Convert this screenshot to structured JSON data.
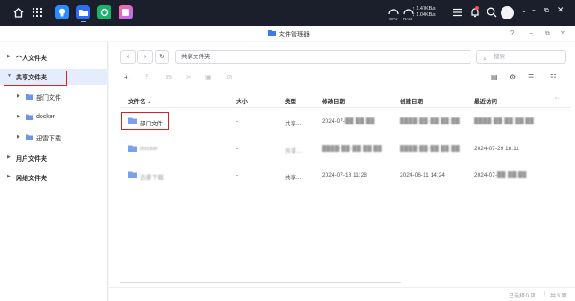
{
  "system_bar": {
    "net_up": "↑ 1.47KB/s",
    "net_down": "↓ 1.04KB/s",
    "cpu_label": "CPU",
    "ram_label": "RAM"
  },
  "window": {
    "title": "文件管理器",
    "help": "?"
  },
  "sidebar": {
    "items": [
      {
        "label": "个人文件夹"
      },
      {
        "label": "共享文件夹"
      },
      {
        "label": "部门文件"
      },
      {
        "label": "docker"
      },
      {
        "label": "迅雷下载"
      },
      {
        "label": "用户文件夹"
      },
      {
        "label": "网络文件夹"
      }
    ]
  },
  "toolbar": {
    "path": "共享文件夹",
    "search_placeholder": "搜索"
  },
  "table": {
    "columns": [
      "文件名",
      "大小",
      "类型",
      "修改日期",
      "创建日期",
      "最近访问"
    ],
    "rows": [
      {
        "name": "部门文件",
        "size": "-",
        "type": "共享...",
        "modified": "2024-07-",
        "created": "",
        "accessed": ""
      },
      {
        "name": "docker",
        "size": "-",
        "type": "共享...",
        "modified": "",
        "created": "",
        "accessed": "2024-07-29 18:11"
      },
      {
        "name": "迅雷下载",
        "size": "-",
        "type": "共享...",
        "modified": "2024-07-18 11:28",
        "created": "2024-06-11 14:24",
        "accessed": "2024-07-"
      }
    ]
  },
  "status": {
    "selected": "已选择 0 项",
    "total": "共 3 项"
  }
}
